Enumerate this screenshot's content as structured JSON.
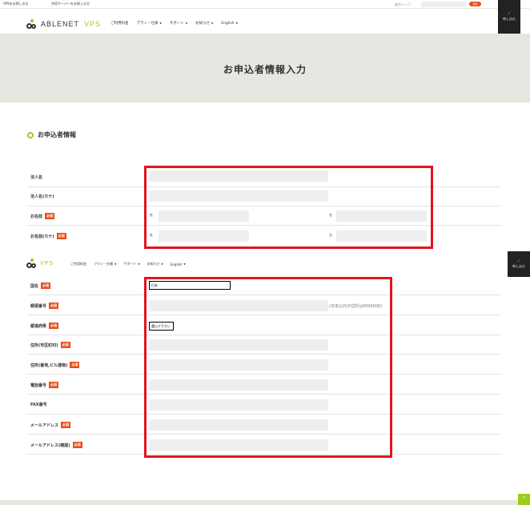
{
  "utility": {
    "links": [
      "VPSをお探しの方",
      "共用サーバーをお探しの方"
    ],
    "site_top": "総合トップ",
    "search_placeholder": "",
    "search_button": "検索"
  },
  "header": {
    "brand": "ABLENET",
    "product": "VPS",
    "nav": [
      "ご利用料金",
      "プラン・仕様",
      "サポート",
      "お知らせ",
      "English"
    ],
    "apply_label": "申し込む"
  },
  "hero_title": "お申込者情報入力",
  "section_title": "お申込者情報",
  "fields_top": [
    {
      "label": "法人名",
      "required": false
    },
    {
      "label": "法人名(カナ)",
      "required": false
    },
    {
      "label": "お名前",
      "required": true,
      "sub1": "姓",
      "sub2": "名"
    },
    {
      "label": "お名前(カナ)",
      "required": true,
      "sub1": "姓",
      "sub2": "名"
    }
  ],
  "required_badge": "必須",
  "fields_bottom": [
    {
      "label": "国名",
      "required": true,
      "value": "日本"
    },
    {
      "label": "郵便番号",
      "required": true,
      "note": "(日本以外の住所は0000000)"
    },
    {
      "label": "都道府県",
      "required": true,
      "value": "選んで下さい"
    },
    {
      "label": "住所(市区町村)",
      "required": true
    },
    {
      "label": "住所(番地,ビル建物)",
      "required": true
    },
    {
      "label": "電話番号",
      "required": true
    },
    {
      "label": "FAX番号",
      "required": false
    },
    {
      "label": "メールアドレス",
      "required": true
    },
    {
      "label": "メールアドレス(確認)",
      "required": true
    }
  ],
  "totop": "^",
  "colors": {
    "accent_green": "#9acd1f",
    "required_orange": "#e94e1b",
    "highlight_red": "#e1141e"
  }
}
